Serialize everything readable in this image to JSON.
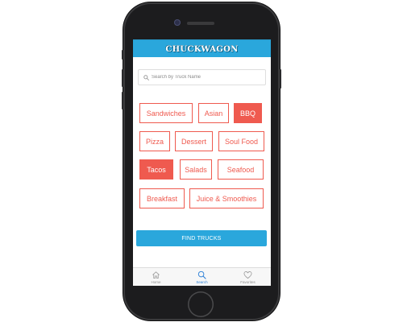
{
  "app": {
    "title": "CHUCKWAGON"
  },
  "search": {
    "placeholder": "Search by Truck Name",
    "value": ""
  },
  "categories": [
    {
      "label": "Sandwiches",
      "selected": false
    },
    {
      "label": "Asian",
      "selected": false
    },
    {
      "label": "BBQ",
      "selected": true
    },
    {
      "label": "Pizza",
      "selected": false
    },
    {
      "label": "Dessert",
      "selected": false
    },
    {
      "label": "Soul Food",
      "selected": false
    },
    {
      "label": "Tacos",
      "selected": true
    },
    {
      "label": "Salads",
      "selected": false
    },
    {
      "label": "Seafood",
      "selected": false
    },
    {
      "label": "Breakfast",
      "selected": false
    },
    {
      "label": "Juice & Smoothies",
      "selected": false
    }
  ],
  "find_button": {
    "label": "FIND TRUCKS"
  },
  "tabs": [
    {
      "label": "Home",
      "icon": "home-icon",
      "active": false
    },
    {
      "label": "Search",
      "icon": "search-icon",
      "active": true
    },
    {
      "label": "Favorites",
      "icon": "heart-icon",
      "active": false
    }
  ],
  "colors": {
    "header": "#2aa7dc",
    "category_accent": "#ef5a4f",
    "button": "#2aa7dc",
    "active_tab": "#2a7fd6"
  }
}
